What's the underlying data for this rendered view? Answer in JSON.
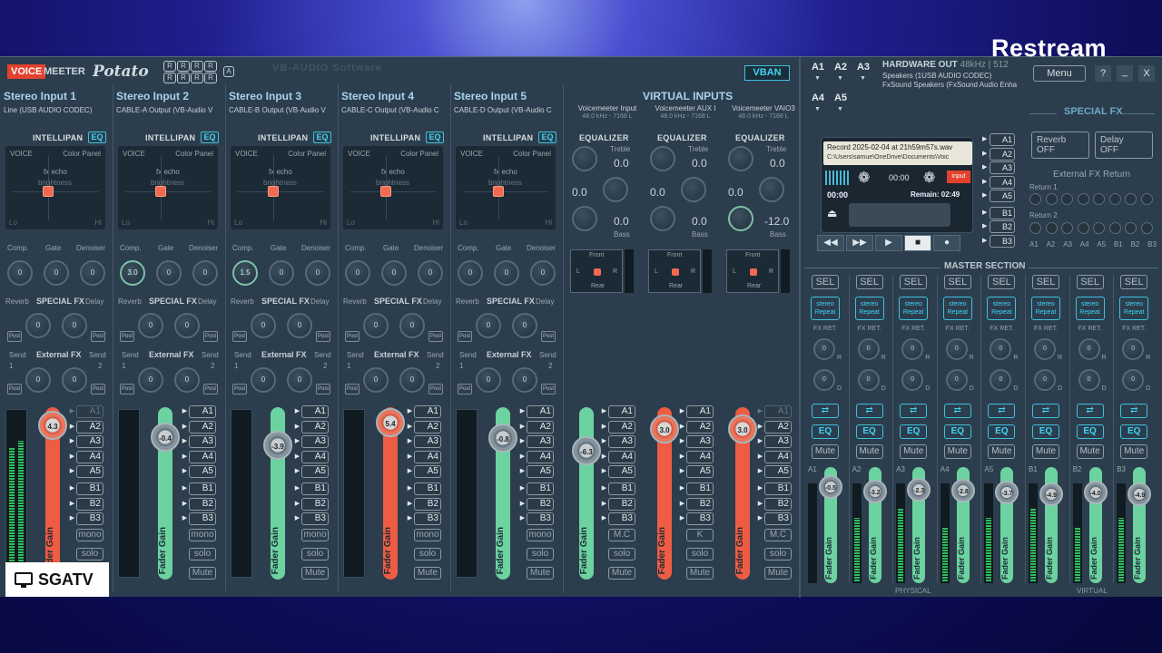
{
  "overlay": {
    "restream": "Restream",
    "sgatv": "SGATV"
  },
  "brand": {
    "voice": "VOICE",
    "meeter": "MEETER",
    "potato": "Potato",
    "r": [
      "R",
      "R",
      "R",
      "R",
      "R",
      "R",
      "R",
      "R"
    ],
    "a": "A",
    "watermark": "VB-AUDIO Software"
  },
  "vban": "VBAN",
  "hw_out": {
    "title": "HARDWARE OUT",
    "rate": "48kHz | 512",
    "dev1": "Speakers (1USB AUDIO  CODEC)",
    "dev2": "FxSound Speakers (FxSound Audio Enha",
    "buttons": [
      "A1",
      "A2",
      "A3",
      "A4",
      "A5"
    ]
  },
  "window": {
    "menu": "Menu",
    "help": "?",
    "min": "_",
    "close": "X"
  },
  "inputs": [
    {
      "name": "Stereo Input 1",
      "dev": "Line (USB AUDIO  CODEC)",
      "intelli": "INTELLIPAN",
      "eq": "EQ",
      "voice": "VOICE",
      "panel": "Color Panel",
      "fx": "fx echo",
      "bright": "brightness",
      "lo": "Lo",
      "hi": "Hi",
      "comp": "Comp.",
      "gate": "Gate",
      "den": "Denoiser",
      "kn": [
        "0",
        "0",
        "0"
      ],
      "reverb": "Reverb",
      "sfx": "SPECIAL FX",
      "delay": "Delay",
      "sk": [
        "0",
        "0"
      ],
      "post": "Post",
      "send": "Send",
      "efx": "External FX",
      "s1": "1",
      "s2": "2",
      "ek": [
        "0",
        "0"
      ],
      "gain": "4.3",
      "red": true,
      "buses": [
        "A1",
        "A2",
        "A3",
        "A4",
        "A5",
        "B1",
        "B2",
        "B3"
      ],
      "mono": "mono",
      "solo": "solo",
      "mute": "Mute",
      "fl": "Fader Gain"
    },
    {
      "name": "Stereo Input 2",
      "dev": "CABLE-A Output (VB-Audio V",
      "intelli": "INTELLIPAN",
      "eq": "EQ",
      "voice": "VOICE",
      "panel": "Color Panel",
      "fx": "fx echo",
      "bright": "brightness",
      "lo": "Lo",
      "hi": "Hi",
      "comp": "Comp.",
      "gate": "Gate",
      "den": "Denoiser",
      "kn": [
        "3.0",
        "0",
        "0"
      ],
      "reverb": "Reverb",
      "sfx": "SPECIAL FX",
      "delay": "Delay",
      "sk": [
        "0",
        "0"
      ],
      "post": "Post",
      "send": "Send",
      "efx": "External FX",
      "s1": "1",
      "s2": "2",
      "ek": [
        "0",
        "0"
      ],
      "gain": "-0.4",
      "red": false,
      "buses": [
        "A1",
        "A2",
        "A3",
        "A4",
        "A5",
        "B1",
        "B2",
        "B3"
      ],
      "mono": "mono",
      "solo": "solo",
      "mute": "Mute",
      "fl": "Fader Gain"
    },
    {
      "name": "Stereo Input 3",
      "dev": "CABLE-B Output (VB-Audio V",
      "intelli": "INTELLIPAN",
      "eq": "EQ",
      "voice": "VOICE",
      "panel": "Color Panel",
      "fx": "fx echo",
      "bright": "brightness",
      "lo": "Lo",
      "hi": "Hi",
      "comp": "Comp.",
      "gate": "Gate",
      "den": "Denoiser",
      "kn": [
        "1.5",
        "0",
        "0"
      ],
      "reverb": "Reverb",
      "sfx": "SPECIAL FX",
      "delay": "Delay",
      "sk": [
        "0",
        "0"
      ],
      "post": "Post",
      "send": "Send",
      "efx": "External FX",
      "s1": "1",
      "s2": "2",
      "ek": [
        "0",
        "0"
      ],
      "gain": "-3.9",
      "red": false,
      "buses": [
        "A1",
        "A2",
        "A3",
        "A4",
        "A5",
        "B1",
        "B2",
        "B3"
      ],
      "mono": "mono",
      "solo": "solo",
      "mute": "Mute",
      "fl": "Fader Gain"
    },
    {
      "name": "Stereo Input 4",
      "dev": "CABLE-C Output (VB-Audio C",
      "intelli": "INTELLIPAN",
      "eq": "EQ",
      "voice": "VOICE",
      "panel": "Color Panel",
      "fx": "fx echo",
      "bright": "brightness",
      "lo": "Lo",
      "hi": "Hi",
      "comp": "Comp.",
      "gate": "Gate",
      "den": "Denoiser",
      "kn": [
        "0",
        "0",
        "0"
      ],
      "reverb": "Reverb",
      "sfx": "SPECIAL FX",
      "delay": "Delay",
      "sk": [
        "0",
        "0"
      ],
      "post": "Post",
      "send": "Send",
      "efx": "External FX",
      "s1": "1",
      "s2": "2",
      "ek": [
        "0",
        "0"
      ],
      "gain": "5.4",
      "red": true,
      "buses": [
        "A1",
        "A2",
        "A3",
        "A4",
        "A5",
        "B1",
        "B2",
        "B3"
      ],
      "mono": "mono",
      "solo": "solo",
      "mute": "Mute",
      "fl": "Fader Gain"
    },
    {
      "name": "Stereo Input 5",
      "dev": "CABLE-D Output (VB-Audio C",
      "intelli": "INTELLIPAN",
      "eq": "EQ",
      "voice": "VOICE",
      "panel": "Color Panel",
      "fx": "fx echo",
      "bright": "brightness",
      "lo": "Lo",
      "hi": "Hi",
      "comp": "Comp.",
      "gate": "Gate",
      "den": "Denoiser",
      "kn": [
        "0",
        "0",
        "0"
      ],
      "reverb": "Reverb",
      "sfx": "SPECIAL FX",
      "delay": "Delay",
      "sk": [
        "0",
        "0"
      ],
      "post": "Post",
      "send": "Send",
      "efx": "External FX",
      "s1": "1",
      "s2": "2",
      "ek": [
        "0",
        "0"
      ],
      "gain": "-0.8",
      "red": false,
      "buses": [
        "A1",
        "A2",
        "A3",
        "A4",
        "A5",
        "B1",
        "B2",
        "B3"
      ],
      "mono": "mono",
      "solo": "solo",
      "mute": "Mute",
      "fl": "Fader Gain"
    }
  ],
  "virtual": {
    "title": "VIRTUAL INPUTS",
    "strips": [
      {
        "name": "Voicemeeter Input",
        "rate": "48.0 kHz - 7168 L",
        "eqt": "EQUALIZER",
        "treble": "Treble",
        "tv": "0.0",
        "mv": "0.0",
        "bass": "Bass",
        "bv": "0.0",
        "front": "Front",
        "rear": "Rear",
        "l": "L",
        "r": "R",
        "gain": "-6.3",
        "red": false,
        "buses": [
          "A1",
          "A2",
          "A3",
          "A4",
          "A5",
          "B1",
          "B2",
          "B3"
        ],
        "mc": "M.C",
        "solo": "solo",
        "mute": "Mute",
        "fl": "Fader Gain"
      },
      {
        "name": "Voicemeeter AUX I",
        "rate": "48.0 kHz - 7168 L",
        "eqt": "EQUALIZER",
        "treble": "Treble",
        "tv": "0.0",
        "mv": "0.0",
        "bass": "Bass",
        "bv": "0.0",
        "front": "Front",
        "rear": "Rear",
        "l": "L",
        "r": "R",
        "gain": "3.0",
        "red": true,
        "buses": [
          "A1",
          "A2",
          "A3",
          "A4",
          "A5",
          "B1",
          "B2",
          "B3"
        ],
        "mc": "K",
        "solo": "solo",
        "mute": "Mute",
        "fl": "Fader Gain"
      },
      {
        "name": "Voicemeeter VAIO3",
        "rate": "48.0 kHz - 7168 L",
        "eqt": "EQUALIZER",
        "treble": "Treble",
        "tv": "0.0",
        "mv": "0.0",
        "bass": "Bass",
        "bv": "-12.0",
        "front": "Front",
        "rear": "Rear",
        "l": "L",
        "r": "R",
        "gain": "3.0",
        "red": true,
        "buses": [
          "A1",
          "A2",
          "A3",
          "A4",
          "A5",
          "B1",
          "B2",
          "B3"
        ],
        "mc": "M.C",
        "solo": "solo",
        "mute": "Mute",
        "fl": "Fader Gain"
      }
    ]
  },
  "recorder": {
    "file": "Record 2025-02-04 at 21h59m57s.wav",
    "path": "C:\\Users\\samue\\OneDrive\\Documents\\Voic",
    "time": "00:00",
    "pos": "00:00",
    "remain": "Remain: 02:49",
    "input": "input",
    "buses": [
      "A1",
      "A2",
      "A3",
      "A4",
      "A5",
      "B1",
      "B2",
      "B3"
    ],
    "ctrl": [
      "◀◀",
      "▶▶",
      "▶",
      "■",
      "●"
    ]
  },
  "special_fx": {
    "title": "SPECIAL FX",
    "reverb": "Reverb",
    "reverb_state": "OFF",
    "delay": "Delay",
    "delay_state": "OFF",
    "ext": "External FX Return",
    "ret1": "Return 1",
    "ret2": "Return 2",
    "labels": [
      "A1",
      "A2",
      "A3",
      "A4",
      "A5",
      "B1",
      "B2",
      "B3"
    ]
  },
  "master": {
    "title": "MASTER SECTION",
    "physical": "PHYSICAL",
    "virtual": "VIRTUAL",
    "cols": [
      {
        "bus": "A1",
        "gain": "-0.5"
      },
      {
        "bus": "A2",
        "gain": "-3.2"
      },
      {
        "bus": "A3",
        "gain": "-2.3"
      },
      {
        "bus": "A4",
        "gain": "-2.8"
      },
      {
        "bus": "A5",
        "gain": "-3.7"
      },
      {
        "bus": "B1",
        "gain": "-4.9"
      },
      {
        "bus": "B2",
        "gain": "-4.0"
      },
      {
        "bus": "B3",
        "gain": "-4.9"
      }
    ],
    "sel": "SEL",
    "rep1": "stereo",
    "rep2": "Repeat",
    "fxret": "FX RET.",
    "kn": "0",
    "r": "R",
    "d": "D",
    "swap": "⇄",
    "eq": "EQ",
    "mute": "Mute",
    "fl": "Fader Gain"
  }
}
